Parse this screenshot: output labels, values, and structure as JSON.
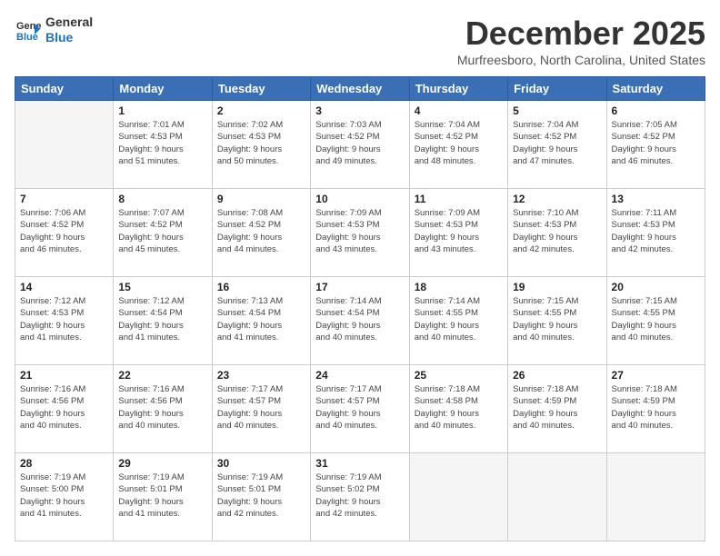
{
  "header": {
    "logo": {
      "line1": "General",
      "line2": "Blue"
    },
    "title": "December 2025",
    "location": "Murfreesboro, North Carolina, United States"
  },
  "weekdays": [
    "Sunday",
    "Monday",
    "Tuesday",
    "Wednesday",
    "Thursday",
    "Friday",
    "Saturday"
  ],
  "weeks": [
    [
      {
        "day": "",
        "info": ""
      },
      {
        "day": "1",
        "info": "Sunrise: 7:01 AM\nSunset: 4:53 PM\nDaylight: 9 hours\nand 51 minutes."
      },
      {
        "day": "2",
        "info": "Sunrise: 7:02 AM\nSunset: 4:53 PM\nDaylight: 9 hours\nand 50 minutes."
      },
      {
        "day": "3",
        "info": "Sunrise: 7:03 AM\nSunset: 4:52 PM\nDaylight: 9 hours\nand 49 minutes."
      },
      {
        "day": "4",
        "info": "Sunrise: 7:04 AM\nSunset: 4:52 PM\nDaylight: 9 hours\nand 48 minutes."
      },
      {
        "day": "5",
        "info": "Sunrise: 7:04 AM\nSunset: 4:52 PM\nDaylight: 9 hours\nand 47 minutes."
      },
      {
        "day": "6",
        "info": "Sunrise: 7:05 AM\nSunset: 4:52 PM\nDaylight: 9 hours\nand 46 minutes."
      }
    ],
    [
      {
        "day": "7",
        "info": "Sunrise: 7:06 AM\nSunset: 4:52 PM\nDaylight: 9 hours\nand 46 minutes."
      },
      {
        "day": "8",
        "info": "Sunrise: 7:07 AM\nSunset: 4:52 PM\nDaylight: 9 hours\nand 45 minutes."
      },
      {
        "day": "9",
        "info": "Sunrise: 7:08 AM\nSunset: 4:52 PM\nDaylight: 9 hours\nand 44 minutes."
      },
      {
        "day": "10",
        "info": "Sunrise: 7:09 AM\nSunset: 4:53 PM\nDaylight: 9 hours\nand 43 minutes."
      },
      {
        "day": "11",
        "info": "Sunrise: 7:09 AM\nSunset: 4:53 PM\nDaylight: 9 hours\nand 43 minutes."
      },
      {
        "day": "12",
        "info": "Sunrise: 7:10 AM\nSunset: 4:53 PM\nDaylight: 9 hours\nand 42 minutes."
      },
      {
        "day": "13",
        "info": "Sunrise: 7:11 AM\nSunset: 4:53 PM\nDaylight: 9 hours\nand 42 minutes."
      }
    ],
    [
      {
        "day": "14",
        "info": "Sunrise: 7:12 AM\nSunset: 4:53 PM\nDaylight: 9 hours\nand 41 minutes."
      },
      {
        "day": "15",
        "info": "Sunrise: 7:12 AM\nSunset: 4:54 PM\nDaylight: 9 hours\nand 41 minutes."
      },
      {
        "day": "16",
        "info": "Sunrise: 7:13 AM\nSunset: 4:54 PM\nDaylight: 9 hours\nand 41 minutes."
      },
      {
        "day": "17",
        "info": "Sunrise: 7:14 AM\nSunset: 4:54 PM\nDaylight: 9 hours\nand 40 minutes."
      },
      {
        "day": "18",
        "info": "Sunrise: 7:14 AM\nSunset: 4:55 PM\nDaylight: 9 hours\nand 40 minutes."
      },
      {
        "day": "19",
        "info": "Sunrise: 7:15 AM\nSunset: 4:55 PM\nDaylight: 9 hours\nand 40 minutes."
      },
      {
        "day": "20",
        "info": "Sunrise: 7:15 AM\nSunset: 4:55 PM\nDaylight: 9 hours\nand 40 minutes."
      }
    ],
    [
      {
        "day": "21",
        "info": "Sunrise: 7:16 AM\nSunset: 4:56 PM\nDaylight: 9 hours\nand 40 minutes."
      },
      {
        "day": "22",
        "info": "Sunrise: 7:16 AM\nSunset: 4:56 PM\nDaylight: 9 hours\nand 40 minutes."
      },
      {
        "day": "23",
        "info": "Sunrise: 7:17 AM\nSunset: 4:57 PM\nDaylight: 9 hours\nand 40 minutes."
      },
      {
        "day": "24",
        "info": "Sunrise: 7:17 AM\nSunset: 4:57 PM\nDaylight: 9 hours\nand 40 minutes."
      },
      {
        "day": "25",
        "info": "Sunrise: 7:18 AM\nSunset: 4:58 PM\nDaylight: 9 hours\nand 40 minutes."
      },
      {
        "day": "26",
        "info": "Sunrise: 7:18 AM\nSunset: 4:59 PM\nDaylight: 9 hours\nand 40 minutes."
      },
      {
        "day": "27",
        "info": "Sunrise: 7:18 AM\nSunset: 4:59 PM\nDaylight: 9 hours\nand 40 minutes."
      }
    ],
    [
      {
        "day": "28",
        "info": "Sunrise: 7:19 AM\nSunset: 5:00 PM\nDaylight: 9 hours\nand 41 minutes."
      },
      {
        "day": "29",
        "info": "Sunrise: 7:19 AM\nSunset: 5:01 PM\nDaylight: 9 hours\nand 41 minutes."
      },
      {
        "day": "30",
        "info": "Sunrise: 7:19 AM\nSunset: 5:01 PM\nDaylight: 9 hours\nand 42 minutes."
      },
      {
        "day": "31",
        "info": "Sunrise: 7:19 AM\nSunset: 5:02 PM\nDaylight: 9 hours\nand 42 minutes."
      },
      {
        "day": "",
        "info": ""
      },
      {
        "day": "",
        "info": ""
      },
      {
        "day": "",
        "info": ""
      }
    ]
  ]
}
